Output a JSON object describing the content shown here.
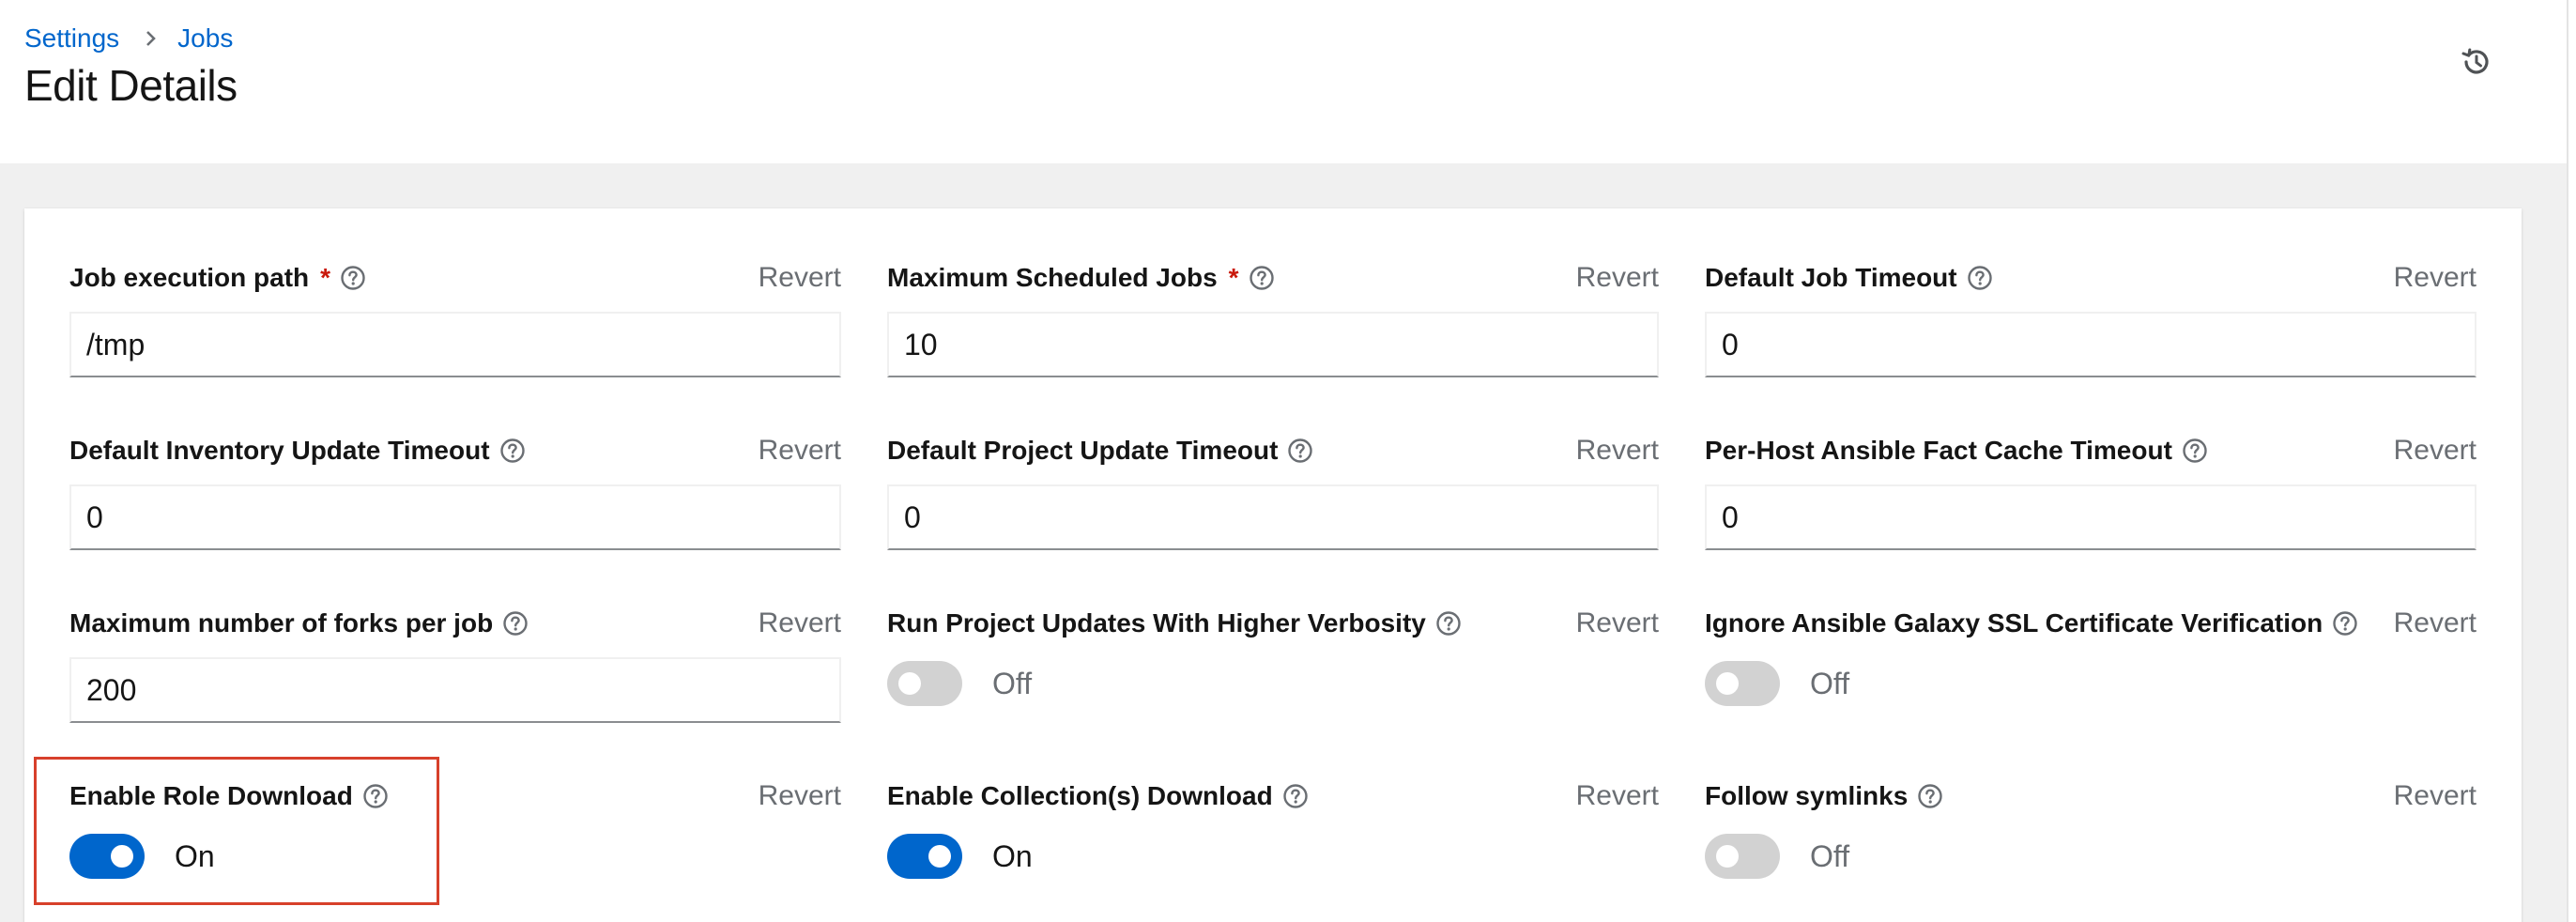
{
  "breadcrumb": {
    "items": [
      "Settings",
      "Jobs"
    ]
  },
  "page_title": "Edit Details",
  "icons": {
    "history": "history-icon",
    "help": "question-circle-icon",
    "separator": "chevron-right-icon"
  },
  "colors": {
    "link": "#0066cc",
    "required": "#c9190b",
    "switch_on": "#0066cc",
    "switch_off": "#d2d2d2",
    "highlight": "#d7402b"
  },
  "revert_label": "Revert",
  "fields": [
    {
      "label": "Job execution path",
      "required": true,
      "type": "text",
      "value": "/tmp"
    },
    {
      "label": "Maximum Scheduled Jobs",
      "required": true,
      "type": "text",
      "value": "10"
    },
    {
      "label": "Default Job Timeout",
      "required": false,
      "type": "text",
      "value": "0"
    },
    {
      "label": "Default Inventory Update Timeout",
      "required": false,
      "type": "text",
      "value": "0"
    },
    {
      "label": "Default Project Update Timeout",
      "required": false,
      "type": "text",
      "value": "0"
    },
    {
      "label": "Per-Host Ansible Fact Cache Timeout",
      "required": false,
      "type": "text",
      "value": "0"
    },
    {
      "label": "Maximum number of forks per job",
      "required": false,
      "type": "text",
      "value": "200"
    },
    {
      "label": "Run Project Updates With Higher Verbosity",
      "required": false,
      "type": "toggle",
      "checked": false,
      "state_text": "Off"
    },
    {
      "label": "Ignore Ansible Galaxy SSL Certificate Verification",
      "required": false,
      "type": "toggle",
      "checked": false,
      "state_text": "Off"
    },
    {
      "label": "Enable Role Download",
      "required": false,
      "type": "toggle",
      "checked": true,
      "state_text": "On"
    },
    {
      "label": "Enable Collection(s) Download",
      "required": false,
      "type": "toggle",
      "checked": true,
      "state_text": "On"
    },
    {
      "label": "Follow symlinks",
      "required": false,
      "type": "toggle",
      "checked": false,
      "state_text": "Off"
    }
  ]
}
